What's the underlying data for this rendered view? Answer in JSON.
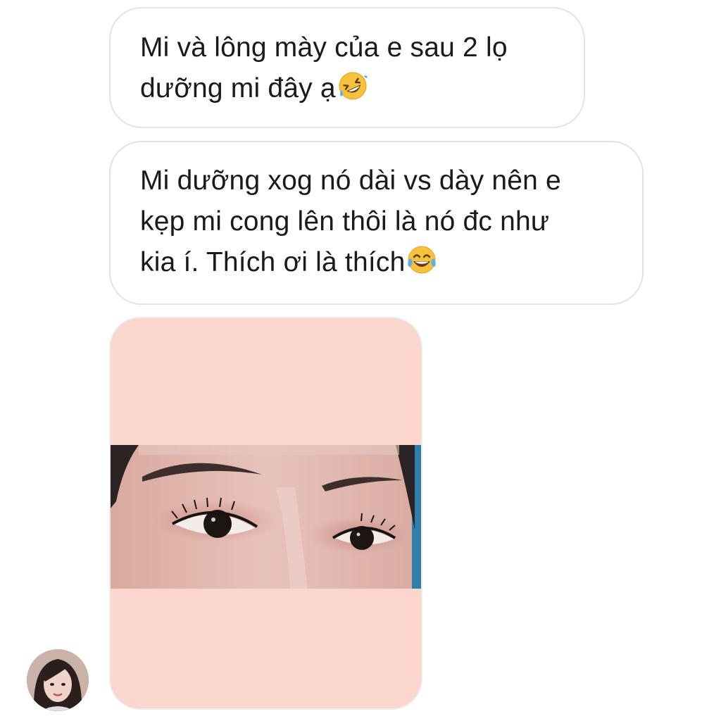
{
  "messages": [
    {
      "lines": [
        "Mi và lông mày của e sau 2 lọ",
        "dưỡng mi đây ạ"
      ],
      "emoji": "rolling-on-floor-laughing"
    },
    {
      "lines": [
        "Mi dưỡng xog nó dài vs dày nên e",
        "kẹp mi cong lên thôi là nó đc như",
        "kia í. Thích ơi là thích"
      ],
      "emoji": "tears-of-joy"
    }
  ],
  "photo": {
    "subject": "close-up of eyes and eyebrows",
    "background_color": "#fbd6cc"
  },
  "avatar": {
    "type": "sender-profile-photo"
  }
}
